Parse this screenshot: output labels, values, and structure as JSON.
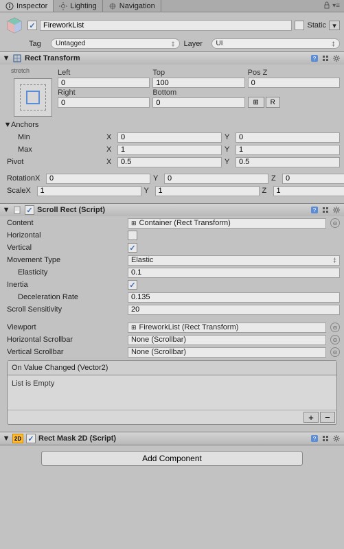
{
  "tabs": {
    "inspector": "Inspector",
    "lighting": "Lighting",
    "navigation": "Navigation"
  },
  "header": {
    "name": "FireworkList",
    "name_checked": true,
    "static_label": "Static",
    "static_checked": false,
    "tag_label": "Tag",
    "tag_value": "Untagged",
    "layer_label": "Layer",
    "layer_value": "UI"
  },
  "rectTransform": {
    "title": "Rect Transform",
    "anchor_preset_h": "stretch",
    "anchor_preset_v": "stretch",
    "left_label": "Left",
    "left": "0",
    "top_label": "Top",
    "top": "100",
    "posz_label": "Pos Z",
    "posz": "0",
    "right_label": "Right",
    "right": "0",
    "bottom_label": "Bottom",
    "bottom": "0",
    "r_btn": "R",
    "anchors_label": "Anchors",
    "min_label": "Min",
    "min_x": "0",
    "min_y": "0",
    "max_label": "Max",
    "max_x": "1",
    "max_y": "1",
    "pivot_label": "Pivot",
    "pivot_x": "0.5",
    "pivot_y": "0.5",
    "rotation_label": "Rotation",
    "rot_x": "0",
    "rot_y": "0",
    "rot_z": "0",
    "scale_label": "Scale",
    "scale_x": "1",
    "scale_y": "1",
    "scale_z": "1"
  },
  "scrollRect": {
    "title": "Scroll Rect (Script)",
    "enabled": true,
    "content_label": "Content",
    "content_value": "Container (Rect Transform)",
    "horizontal_label": "Horizontal",
    "horizontal_checked": false,
    "vertical_label": "Vertical",
    "vertical_checked": true,
    "movement_label": "Movement Type",
    "movement_value": "Elastic",
    "elasticity_label": "Elasticity",
    "elasticity": "0.1",
    "inertia_label": "Inertia",
    "inertia_checked": true,
    "decel_label": "Deceleration Rate",
    "decel": "0.135",
    "sensitivity_label": "Scroll Sensitivity",
    "sensitivity": "20",
    "viewport_label": "Viewport",
    "viewport_value": "FireworkList (Rect Transform)",
    "hscroll_label": "Horizontal Scrollbar",
    "hscroll_value": "None (Scrollbar)",
    "vscroll_label": "Vertical Scrollbar",
    "vscroll_value": "None (Scrollbar)",
    "event_title": "On Value Changed (Vector2)",
    "event_empty": "List is Empty"
  },
  "rectMask": {
    "title": "Rect Mask 2D (Script)",
    "enabled": true
  },
  "addComponent": "Add Component",
  "axis": {
    "x": "X",
    "y": "Y",
    "z": "Z"
  }
}
